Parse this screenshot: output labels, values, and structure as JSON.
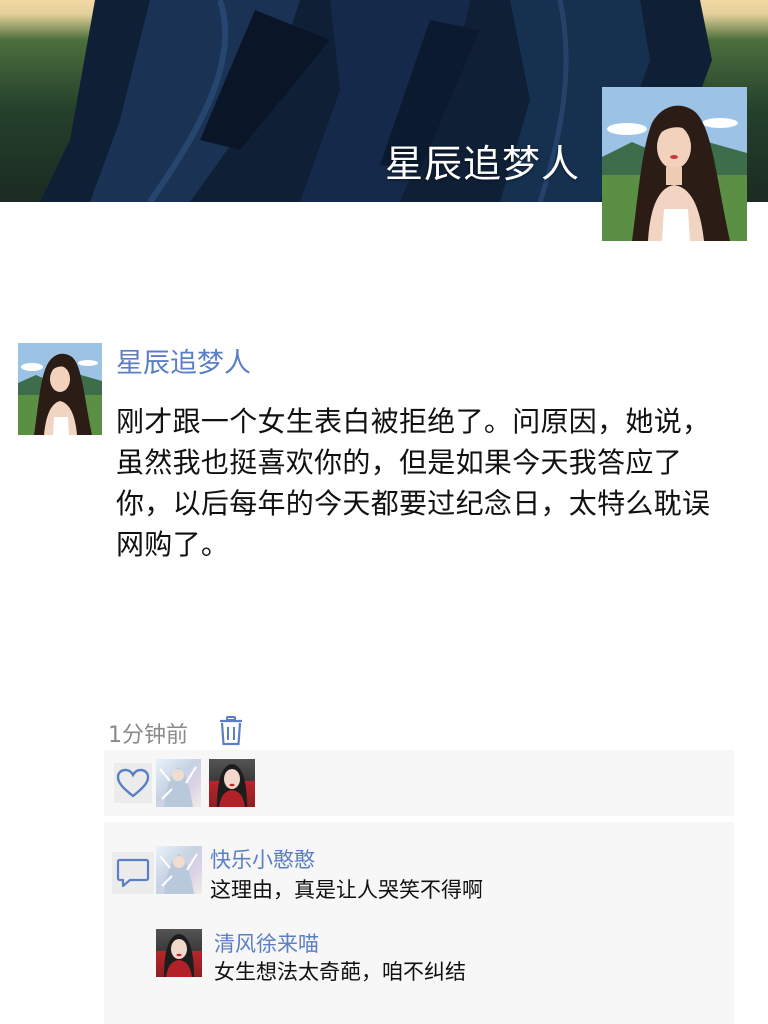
{
  "profile": {
    "name": "星辰追梦人"
  },
  "post": {
    "author": "星辰追梦人",
    "text": "刚才跟一个女生表白被拒绝了。问原因，她说，虽然我也挺喜欢你的，但是如果今天我答应了你，以后每年的今天都要过纪念日，太特么耽误网购了。",
    "time": "1分钟前"
  },
  "likes": {
    "count": 2
  },
  "comments": [
    {
      "author": "快乐小憨憨",
      "text": "这理由，真是让人哭笑不得啊"
    },
    {
      "author": "清风徐来喵",
      "text": "女生想法太奇葩，咱不纠结"
    }
  ],
  "colors": {
    "link": "#5a7fc6",
    "time": "#8a8a8a",
    "panel_bg": "#f7f7f7",
    "icon": "#5a7fc6"
  }
}
